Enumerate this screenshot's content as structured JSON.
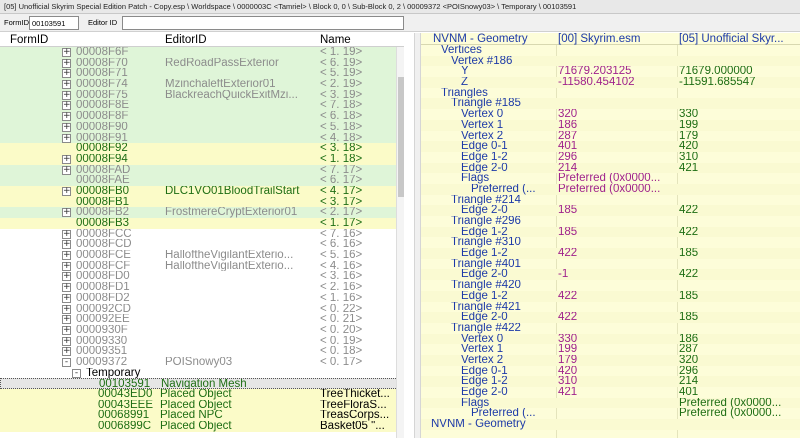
{
  "window": {
    "title": "[05] Unofficial Skyrim Special Edition Patch - Copy.esp \\ Worldspace \\ 0000003C <Tamriel> \\ Block 0, 0 \\ Sub-Block 0, 2 \\ 00009372 <POISnowy03> \\ Temporary \\ 00103591"
  },
  "filter": {
    "formid_label": "FormID",
    "formid_value": "00103591",
    "editorid_label": "Editor ID",
    "editorid_value": ""
  },
  "left_pane": {
    "columns": [
      "FormID",
      "EditorID",
      "Name"
    ],
    "rows": [
      {
        "expand": "+",
        "formid": "00008F6F",
        "editorid": "",
        "name": "< 1. 19>",
        "bg": "g",
        "tone": "gray"
      },
      {
        "expand": "+",
        "formid": "00008F70",
        "editorid": "RedRoadPassExterior",
        "name": "< 6. 19>",
        "bg": "g",
        "tone": "gray"
      },
      {
        "expand": "+",
        "formid": "00008F71",
        "editorid": "",
        "name": "< 5. 19>",
        "bg": "g",
        "tone": "gray"
      },
      {
        "expand": "+",
        "formid": "00008F74",
        "editorid": "MzinchaleftExterior01",
        "name": "< 2. 19>",
        "bg": "g",
        "tone": "gray"
      },
      {
        "expand": "+",
        "formid": "00008F75",
        "editorid": "BlackreachQuickExitMzi...",
        "name": "< 3. 19>",
        "bg": "g",
        "tone": "gray"
      },
      {
        "expand": "+",
        "formid": "00008F8E",
        "editorid": "",
        "name": "< 7. 18>",
        "bg": "g",
        "tone": "gray"
      },
      {
        "expand": "+",
        "formid": "00008F8F",
        "editorid": "",
        "name": "< 6. 18>",
        "bg": "g",
        "tone": "gray"
      },
      {
        "expand": "+",
        "formid": "00008F90",
        "editorid": "",
        "name": "< 5. 18>",
        "bg": "g",
        "tone": "gray"
      },
      {
        "expand": "+",
        "formid": "00008F91",
        "editorid": "",
        "name": "< 4. 18>",
        "bg": "g",
        "tone": "gray"
      },
      {
        "expand": "",
        "formid": "00008F92",
        "editorid": "",
        "name": "< 3. 18>",
        "bg": "y",
        "tone": "green"
      },
      {
        "expand": "+",
        "formid": "00008F94",
        "editorid": "",
        "name": "< 1. 18>",
        "bg": "y",
        "tone": "green"
      },
      {
        "expand": "+",
        "formid": "00008FAD",
        "editorid": "",
        "name": "< 7. 17>",
        "bg": "g",
        "tone": "gray"
      },
      {
        "expand": "",
        "formid": "00008FAE",
        "editorid": "",
        "name": "< 6. 17>",
        "bg": "g",
        "tone": "gray"
      },
      {
        "expand": "+",
        "formid": "00008FB0",
        "editorid": "DLC1VO01BloodTrailStart",
        "name": "< 4. 17>",
        "bg": "y",
        "tone": "green"
      },
      {
        "expand": "",
        "formid": "00008FB1",
        "editorid": "",
        "name": "< 3. 17>",
        "bg": "y",
        "tone": "green"
      },
      {
        "expand": "+",
        "formid": "00008FB2",
        "editorid": "FrostmereCryptExterior01",
        "name": "< 2. 17>",
        "bg": "g",
        "tone": "gray"
      },
      {
        "expand": "",
        "formid": "00008FB3",
        "editorid": "",
        "name": "< 1. 17>",
        "bg": "y",
        "tone": "green"
      },
      {
        "expand": "+",
        "formid": "00008FCC",
        "editorid": "",
        "name": "< 7. 16>",
        "bg": "w",
        "tone": "gray"
      },
      {
        "expand": "+",
        "formid": "00008FCD",
        "editorid": "",
        "name": "< 6. 16>",
        "bg": "w",
        "tone": "gray"
      },
      {
        "expand": "+",
        "formid": "00008FCE",
        "editorid": "HalloftheVigilantExterio...",
        "name": "< 5. 16>",
        "bg": "w",
        "tone": "gray"
      },
      {
        "expand": "+",
        "formid": "00008FCF",
        "editorid": "HalloftheVigilantExterio...",
        "name": "< 4. 16>",
        "bg": "w",
        "tone": "gray"
      },
      {
        "expand": "+",
        "formid": "00008FD0",
        "editorid": "",
        "name": "< 3. 16>",
        "bg": "w",
        "tone": "gray"
      },
      {
        "expand": "+",
        "formid": "00008FD1",
        "editorid": "",
        "name": "< 2. 16>",
        "bg": "w",
        "tone": "gray"
      },
      {
        "expand": "+",
        "formid": "00008FD2",
        "editorid": "",
        "name": "< 1. 16>",
        "bg": "w",
        "tone": "gray"
      },
      {
        "expand": "+",
        "formid": "000092CD",
        "editorid": "",
        "name": "< 0. 22>",
        "bg": "w",
        "tone": "gray"
      },
      {
        "expand": "+",
        "formid": "000092EE",
        "editorid": "",
        "name": "< 0. 21>",
        "bg": "w",
        "tone": "gray"
      },
      {
        "expand": "+",
        "formid": "0000930F",
        "editorid": "",
        "name": "< 0. 20>",
        "bg": "w",
        "tone": "gray"
      },
      {
        "expand": "+",
        "formid": "00009330",
        "editorid": "",
        "name": "< 0. 19>",
        "bg": "w",
        "tone": "gray"
      },
      {
        "expand": "+",
        "formid": "00009351",
        "editorid": "",
        "name": "< 0. 18>",
        "bg": "w",
        "tone": "gray"
      },
      {
        "expand": "-",
        "formid": "00009372",
        "editorid": "POISnowy03",
        "name": "< 0. 17>",
        "bg": "w",
        "tone": "gray"
      }
    ],
    "temporary_label": "Temporary",
    "children": [
      {
        "formid": "00103591",
        "editorid": "Navigation Mesh",
        "name": "",
        "bg": "sel",
        "tone": "green"
      },
      {
        "formid": "00043ED0",
        "editorid": "Placed Object",
        "name": "TreeThicket...",
        "bg": "y",
        "tone": "green"
      },
      {
        "formid": "00043EEE",
        "editorid": "Placed Object",
        "name": "TreeFloraS...",
        "bg": "y",
        "tone": "green"
      },
      {
        "formid": "00068991",
        "editorid": "Placed NPC",
        "name": "TreasCorps...",
        "bg": "y",
        "tone": "green"
      },
      {
        "formid": "0006899C",
        "editorid": "Placed Object",
        "name": "Basket05 \"...",
        "bg": "y",
        "tone": "green"
      }
    ]
  },
  "right_pane": {
    "headers": [
      "NVNM - Geometry",
      "[00] Skyrim.esm",
      "[05] Unofficial Skyr..."
    ],
    "rows": [
      {
        "indent": 1,
        "label": "Vertices",
        "v1": "",
        "v2": ""
      },
      {
        "indent": 2,
        "label": "Vertex #186",
        "v1": "",
        "v2": ""
      },
      {
        "indent": 3,
        "label": "Y",
        "v1": "71679.203125",
        "v2": "71679.000000"
      },
      {
        "indent": 3,
        "label": "Z",
        "v1": "-11580.454102",
        "v2": "-11591.685547"
      },
      {
        "indent": 1,
        "label": "Triangles",
        "v1": "",
        "v2": ""
      },
      {
        "indent": 2,
        "label": "Triangle #185",
        "v1": "",
        "v2": ""
      },
      {
        "indent": 3,
        "label": "Vertex 0",
        "v1": "320",
        "v2": "330"
      },
      {
        "indent": 3,
        "label": "Vertex 1",
        "v1": "186",
        "v2": "199"
      },
      {
        "indent": 3,
        "label": "Vertex 2",
        "v1": "287",
        "v2": "179"
      },
      {
        "indent": 3,
        "label": "Edge 0-1",
        "v1": "401",
        "v2": "420"
      },
      {
        "indent": 3,
        "label": "Edge 1-2",
        "v1": "296",
        "v2": "310"
      },
      {
        "indent": 3,
        "label": "Edge 2-0",
        "v1": "214",
        "v2": "421"
      },
      {
        "indent": 3,
        "label": "Flags",
        "v1": "Preferred (0x0000...",
        "v2": ""
      },
      {
        "indent": 4,
        "label": "Preferred (...",
        "v1": "Preferred (0x0000...",
        "v2": ""
      },
      {
        "indent": 2,
        "label": "Triangle #214",
        "v1": "",
        "v2": ""
      },
      {
        "indent": 3,
        "label": "Edge 2-0",
        "v1": "185",
        "v2": "422"
      },
      {
        "indent": 2,
        "label": "Triangle #296",
        "v1": "",
        "v2": ""
      },
      {
        "indent": 3,
        "label": "Edge 1-2",
        "v1": "185",
        "v2": "422"
      },
      {
        "indent": 2,
        "label": "Triangle #310",
        "v1": "",
        "v2": ""
      },
      {
        "indent": 3,
        "label": "Edge 1-2",
        "v1": "422",
        "v2": "185"
      },
      {
        "indent": 2,
        "label": "Triangle #401",
        "v1": "",
        "v2": ""
      },
      {
        "indent": 3,
        "label": "Edge 2-0",
        "v1": "-1",
        "v2": "422"
      },
      {
        "indent": 2,
        "label": "Triangle #420",
        "v1": "",
        "v2": ""
      },
      {
        "indent": 3,
        "label": "Edge 1-2",
        "v1": "422",
        "v2": "185"
      },
      {
        "indent": 2,
        "label": "Triangle #421",
        "v1": "",
        "v2": ""
      },
      {
        "indent": 3,
        "label": "Edge 2-0",
        "v1": "422",
        "v2": "185"
      },
      {
        "indent": 2,
        "label": "Triangle #422",
        "v1": "",
        "v2": ""
      },
      {
        "indent": 3,
        "label": "Vertex 0",
        "v1": "330",
        "v2": "186"
      },
      {
        "indent": 3,
        "label": "Vertex 1",
        "v1": "199",
        "v2": "287"
      },
      {
        "indent": 3,
        "label": "Vertex 2",
        "v1": "179",
        "v2": "320"
      },
      {
        "indent": 3,
        "label": "Edge 0-1",
        "v1": "420",
        "v2": "296"
      },
      {
        "indent": 3,
        "label": "Edge 1-2",
        "v1": "310",
        "v2": "214"
      },
      {
        "indent": 3,
        "label": "Edge 2-0",
        "v1": "421",
        "v2": "401"
      },
      {
        "indent": 3,
        "label": "Flags",
        "v1": "",
        "v2": "Preferred (0x0000..."
      },
      {
        "indent": 4,
        "label": "Preferred (...",
        "v1": "",
        "v2": "Preferred (0x0000..."
      },
      {
        "indent": 0,
        "label": "NVNM - Geometry",
        "v1": "",
        "v2": ""
      }
    ]
  },
  "colors": {
    "green_row": "#dff5d8",
    "yellow_row": "#fbfbc8",
    "right_bg": "#fdfdd9",
    "label_blue": "#1d3aa8",
    "value_magenta": "#a0238c",
    "value_green": "#1e6e14"
  }
}
